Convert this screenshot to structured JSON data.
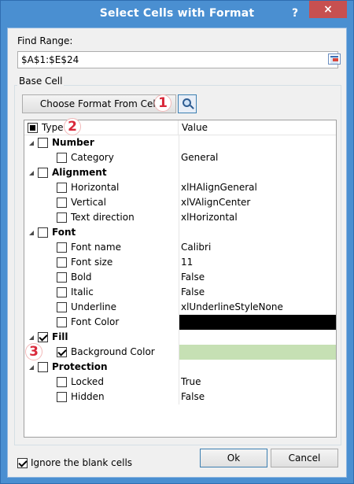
{
  "window": {
    "title": "Select Cells with Format",
    "help_label": "?",
    "close_label": "×"
  },
  "find_range": {
    "label": "Find Range:",
    "value": "$A$1:$E$24"
  },
  "base_cell": {
    "label": "Base Cell",
    "choose_label": "Choose Format From Cell"
  },
  "badges": {
    "one": "1",
    "two": "2",
    "three": "3"
  },
  "tree": {
    "header_type": "Type",
    "header_value": "Value",
    "groups": [
      {
        "name": "Number",
        "checked": false,
        "items": [
          {
            "name": "Category",
            "value": "General",
            "checked": false
          }
        ]
      },
      {
        "name": "Alignment",
        "checked": false,
        "items": [
          {
            "name": "Horizontal",
            "value": "xlHAlignGeneral",
            "checked": false
          },
          {
            "name": "Vertical",
            "value": "xlVAlignCenter",
            "checked": false
          },
          {
            "name": "Text direction",
            "value": "xlHorizontal",
            "checked": false
          }
        ]
      },
      {
        "name": "Font",
        "checked": false,
        "items": [
          {
            "name": "Font name",
            "value": "Calibri",
            "checked": false
          },
          {
            "name": "Font size",
            "value": "11",
            "checked": false
          },
          {
            "name": "Bold",
            "value": "False",
            "checked": false
          },
          {
            "name": "Italic",
            "value": "False",
            "checked": false
          },
          {
            "name": "Underline",
            "value": "xlUnderlineStyleNone",
            "checked": false
          },
          {
            "name": "Font Color",
            "value": "",
            "swatch": "#000000",
            "checked": false
          }
        ]
      },
      {
        "name": "Fill",
        "checked": true,
        "items": [
          {
            "name": "Background Color",
            "value": "",
            "swatch": "#c6e0b4",
            "checked": true
          }
        ]
      },
      {
        "name": "Protection",
        "checked": false,
        "items": [
          {
            "name": "Locked",
            "value": "True",
            "checked": false
          },
          {
            "name": "Hidden",
            "value": "False",
            "checked": false
          }
        ]
      }
    ]
  },
  "footer": {
    "ignore_blank_label": "Ignore the blank cells",
    "ignore_blank_checked": true,
    "ok_label": "Ok",
    "cancel_label": "Cancel"
  },
  "colors": {
    "title_bar": "#4a8fd1",
    "close_button": "#c75050",
    "badge": "#d9283a"
  }
}
